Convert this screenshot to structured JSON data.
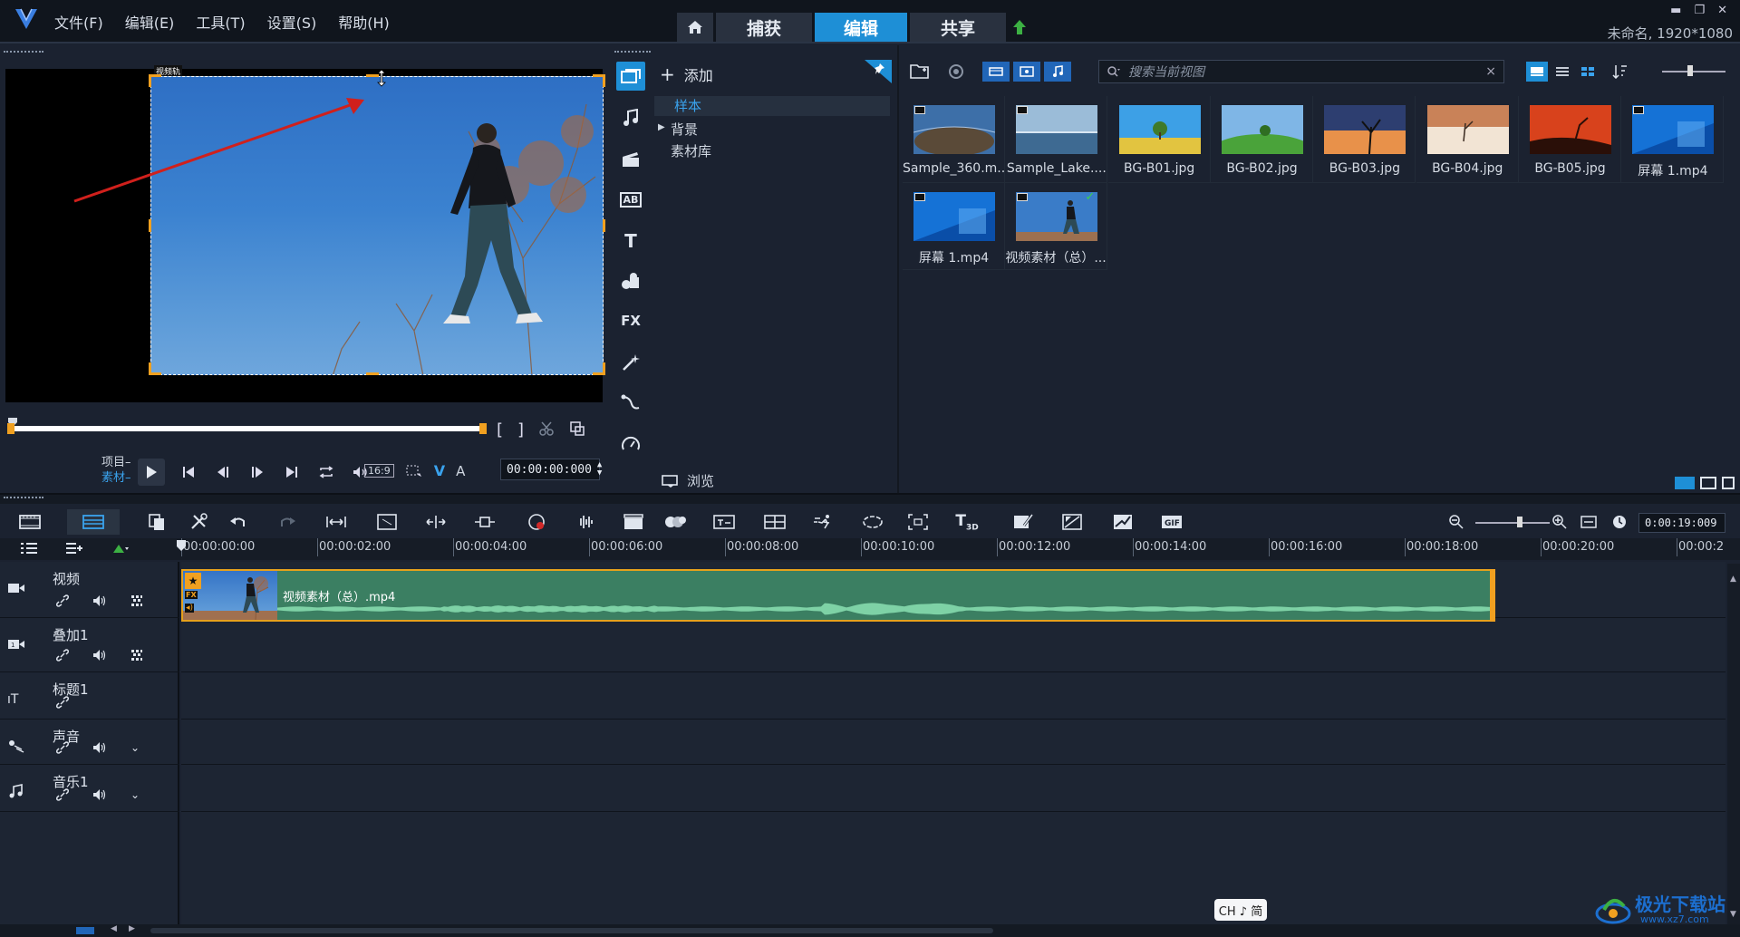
{
  "app": {
    "menu": [
      "文件(F)",
      "编辑(E)",
      "工具(T)",
      "设置(S)",
      "帮助(H)"
    ],
    "mode_tabs": [
      "捕获",
      "编辑",
      "共享"
    ],
    "project_info": "未命名, 1920*1080",
    "accent": "#1e8fd6"
  },
  "preview": {
    "frame_label": "视频轨",
    "mode_project": "项目",
    "mode_clip": "素材",
    "aspect_label": "16:9",
    "timecode": "00:00:00:000",
    "v_label": "V",
    "a_label": "A"
  },
  "library": {
    "add_label": "添加",
    "tree": [
      "样本",
      "背景",
      "素材库"
    ],
    "browse_label": "浏览",
    "search_placeholder": "搜索当前视图",
    "items": [
      {
        "name": "Sample_360.m...",
        "video": true,
        "icon": "panorama-thumb"
      },
      {
        "name": "Sample_Lake....",
        "video": true,
        "icon": "lake-thumb"
      },
      {
        "name": "BG-B01.jpg",
        "video": false,
        "icon": "tree-field-thumb"
      },
      {
        "name": "BG-B02.jpg",
        "video": false,
        "icon": "green-hill-thumb"
      },
      {
        "name": "BG-B03.jpg",
        "video": false,
        "icon": "sunset-tree-thumb"
      },
      {
        "name": "BG-B04.jpg",
        "video": false,
        "icon": "desert-thumb"
      },
      {
        "name": "BG-B05.jpg",
        "video": false,
        "icon": "red-sky-thumb"
      },
      {
        "name": "屏幕 1.mp4",
        "video": true,
        "icon": "screen-thumb"
      },
      {
        "name": "屏幕 1.mp4",
        "video": true,
        "icon": "screen-thumb"
      },
      {
        "name": "视频素材（总）....",
        "video": true,
        "icon": "walking-man-thumb",
        "checked": true
      }
    ]
  },
  "timeline": {
    "duration": "0:00:19:009",
    "ruler": [
      "00:00:00:00",
      "00:00:02:00",
      "00:00:04:00",
      "00:00:06:00",
      "00:00:08:00",
      "00:00:10:00",
      "00:00:12:00",
      "00:00:14:00",
      "00:00:16:00",
      "00:00:18:00",
      "00:00:20:00",
      "00:00:2"
    ],
    "tracks": [
      {
        "name": "视频",
        "icon": "video-track-icon"
      },
      {
        "name": "叠加1",
        "icon": "overlay-track-icon"
      },
      {
        "name": "标题1",
        "icon": "title-track-icon"
      },
      {
        "name": "声音",
        "icon": "voice-track-icon"
      },
      {
        "name": "音乐1",
        "icon": "music-track-icon"
      }
    ],
    "clip": {
      "name": "视频素材（总）.mp4",
      "fx": "FX"
    }
  },
  "taskbar": {
    "ime": "CH ♪ 简"
  },
  "watermark": {
    "title": "极光下载站",
    "url": "www.xz7.com"
  }
}
